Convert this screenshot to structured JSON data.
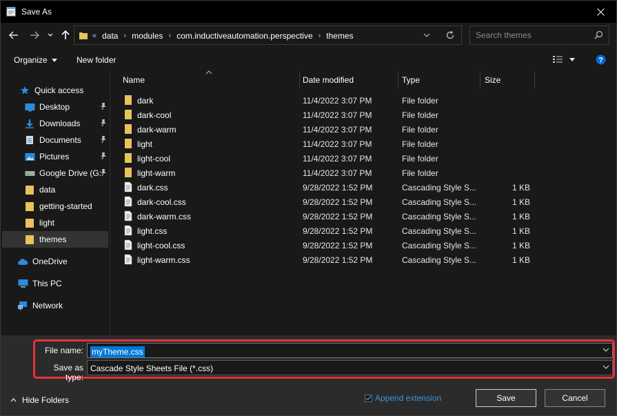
{
  "window": {
    "title": "Save As"
  },
  "nav": {
    "breadcrumb_lead": "«",
    "breadcrumbs": [
      "data",
      "modules",
      "com.inductiveautomation.perspective",
      "themes"
    ],
    "search_placeholder": "Search themes"
  },
  "toolbar": {
    "organize_label": "Organize",
    "new_folder_label": "New folder"
  },
  "sidebar": {
    "items": [
      {
        "label": "Quick access",
        "icon": "star-icon"
      },
      {
        "label": "Desktop",
        "icon": "desktop-icon",
        "pinned": true
      },
      {
        "label": "Downloads",
        "icon": "download-icon",
        "pinned": true
      },
      {
        "label": "Documents",
        "icon": "document-icon",
        "pinned": true
      },
      {
        "label": "Pictures",
        "icon": "picture-icon",
        "pinned": true
      },
      {
        "label": "Google Drive (G:",
        "icon": "drive-icon",
        "pinned": true
      },
      {
        "label": "data",
        "icon": "folder-icon"
      },
      {
        "label": "getting-started",
        "icon": "folder-icon"
      },
      {
        "label": "light",
        "icon": "folder-icon"
      },
      {
        "label": "themes",
        "icon": "folder-icon",
        "selected": true
      },
      {
        "label": "OneDrive",
        "icon": "cloud-icon"
      },
      {
        "label": "This PC",
        "icon": "computer-icon"
      },
      {
        "label": "Network",
        "icon": "network-icon"
      }
    ]
  },
  "filelist": {
    "columns": [
      "Name",
      "Date modified",
      "Type",
      "Size"
    ],
    "rows": [
      {
        "name": "dark",
        "date": "11/4/2022 3:07 PM",
        "type": "File folder",
        "size": "",
        "kind": "folder"
      },
      {
        "name": "dark-cool",
        "date": "11/4/2022 3:07 PM",
        "type": "File folder",
        "size": "",
        "kind": "folder"
      },
      {
        "name": "dark-warm",
        "date": "11/4/2022 3:07 PM",
        "type": "File folder",
        "size": "",
        "kind": "folder"
      },
      {
        "name": "light",
        "date": "11/4/2022 3:07 PM",
        "type": "File folder",
        "size": "",
        "kind": "folder"
      },
      {
        "name": "light-cool",
        "date": "11/4/2022 3:07 PM",
        "type": "File folder",
        "size": "",
        "kind": "folder"
      },
      {
        "name": "light-warm",
        "date": "11/4/2022 3:07 PM",
        "type": "File folder",
        "size": "",
        "kind": "folder"
      },
      {
        "name": "dark.css",
        "date": "9/28/2022 1:52 PM",
        "type": "Cascading Style S...",
        "size": "1 KB",
        "kind": "css"
      },
      {
        "name": "dark-cool.css",
        "date": "9/28/2022 1:52 PM",
        "type": "Cascading Style S...",
        "size": "1 KB",
        "kind": "css"
      },
      {
        "name": "dark-warm.css",
        "date": "9/28/2022 1:52 PM",
        "type": "Cascading Style S...",
        "size": "1 KB",
        "kind": "css"
      },
      {
        "name": "light.css",
        "date": "9/28/2022 1:52 PM",
        "type": "Cascading Style S...",
        "size": "1 KB",
        "kind": "css"
      },
      {
        "name": "light-cool.css",
        "date": "9/28/2022 1:52 PM",
        "type": "Cascading Style S...",
        "size": "1 KB",
        "kind": "css"
      },
      {
        "name": "light-warm.css",
        "date": "9/28/2022 1:52 PM",
        "type": "Cascading Style S...",
        "size": "1 KB",
        "kind": "css"
      }
    ]
  },
  "form": {
    "filename_label": "File name:",
    "filename_value": "myTheme.css",
    "savetype_label": "Save as type:",
    "savetype_value": "Cascade Style Sheets File (*.css)"
  },
  "footer": {
    "hide_folders_label": "Hide Folders",
    "append_extension_label": "Append extension",
    "append_extension_checked": true,
    "save_label": "Save",
    "cancel_label": "Cancel"
  },
  "colors": {
    "folder": "#e8c25c",
    "accent": "#0078d7",
    "highlight_border": "#e5323c",
    "link": "#3a96dd"
  }
}
